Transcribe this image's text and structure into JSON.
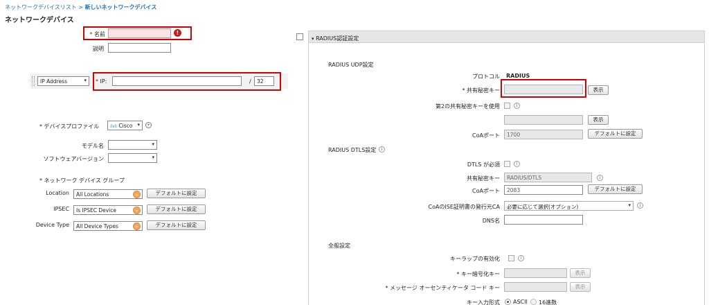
{
  "breadcrumb": {
    "list_link": "ネットワークデバイスリスト",
    "separator": ">",
    "current": "新しいネットワークデバイス"
  },
  "page_title": "ネットワークデバイス",
  "left": {
    "name_label": "名前",
    "name_value": "",
    "desc_label": "説明",
    "desc_value": "",
    "ip_type": "IP Address",
    "ip_label": "IP",
    "ip_value": "",
    "ip_slash": "/",
    "ip_mask": "32",
    "profile_label": "デバイスプロファイル",
    "profile_value": "Cisco",
    "model_label": "モデル名",
    "model_value": "",
    "software_label": "ソフトウェアバージョン",
    "software_value": "",
    "group_label": "ネットワーク デバイス グループ",
    "groups": [
      {
        "label": "Location",
        "value": "All Locations",
        "button": "デフォルトに設定"
      },
      {
        "label": "IPSEC",
        "value": "Is IPSEC Device",
        "button": "デフォルトに設定"
      },
      {
        "label": "Device Type",
        "value": "All Device Types",
        "button": "デフォルトに設定"
      }
    ]
  },
  "radius": {
    "panel_title": "RADIUS認証設定",
    "udp_section": "RADIUS UDP設定",
    "protocol_label": "プロトコル",
    "protocol_value": "RADIUS",
    "secret_label": "共有秘密キー",
    "secret_value": "",
    "show_btn": "表示",
    "second_secret_label": "第2の共有秘密キーを使用",
    "second_secret_value": "",
    "coa_label": "CoAポート",
    "coa_value": "1700",
    "default_btn": "デフォルトに設定",
    "dtls_section": "RADIUS DTLS設定",
    "dtls_required_label": "DTLS が必須",
    "dtls_secret_label": "共有秘密キー",
    "dtls_secret_value": "RADIUS/DTLS",
    "dtls_coa_label": "CoAポート",
    "dtls_coa_value": "2083",
    "ca_label": "CoAのISE証明書の発行元CA",
    "ca_value": "必要に応じて選択(オプション)",
    "dns_label": "DNS名",
    "dns_value": "",
    "general_section": "全般設定",
    "keywrap_label": "キーラップの有効化",
    "enc_key_label": "キー暗号化キー",
    "enc_key_value": "",
    "mac_key_label": "メッセージ オーセンティケータ コード キー",
    "mac_key_value": "",
    "key_format_label": "キー入力形式",
    "key_format_ascii": "ASCII",
    "key_format_hex": "16進数"
  }
}
